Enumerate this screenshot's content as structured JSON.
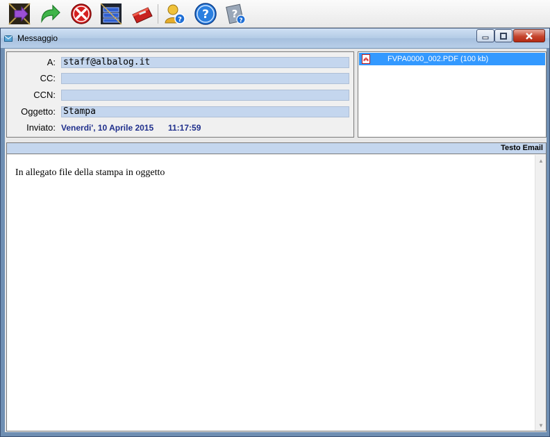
{
  "toolbar": {
    "buttons": [
      {
        "icon": "exit-door-icon",
        "name": "exit-button"
      },
      {
        "icon": "forward-arrow-icon",
        "name": "forward-button"
      },
      {
        "icon": "delete-icon",
        "name": "delete-button"
      },
      {
        "icon": "archive-icon",
        "name": "archive-button"
      },
      {
        "icon": "toolbox-icon",
        "name": "tools-button"
      },
      {
        "icon": "user-help-icon",
        "name": "user-help-button"
      },
      {
        "icon": "help-icon",
        "name": "help-button"
      },
      {
        "icon": "help-docs-icon",
        "name": "help-docs-button"
      }
    ]
  },
  "window": {
    "title": "Messaggio"
  },
  "header": {
    "to_label": "A:",
    "to_value": "staff@albalog.it",
    "cc_label": "CC:",
    "cc_value": "",
    "bcc_label": "CCN:",
    "bcc_value": "",
    "subject_label": "Oggetto:",
    "subject_value": "Stampa",
    "sent_label": "Inviato:",
    "sent_date": "Venerdi', 10 Aprile 2015",
    "sent_time": "11:17:59"
  },
  "attachments": [
    {
      "name": "FVPA0000_002.PDF (100 kb)",
      "icon": "pdf-icon"
    }
  ],
  "body": {
    "section_label": "Testo Email",
    "text": "In allegato file della stampa in oggetto"
  },
  "colors": {
    "field_bg": "#c4d6ee",
    "selection": "#3399ff",
    "sent_text": "#1f2f8c"
  }
}
